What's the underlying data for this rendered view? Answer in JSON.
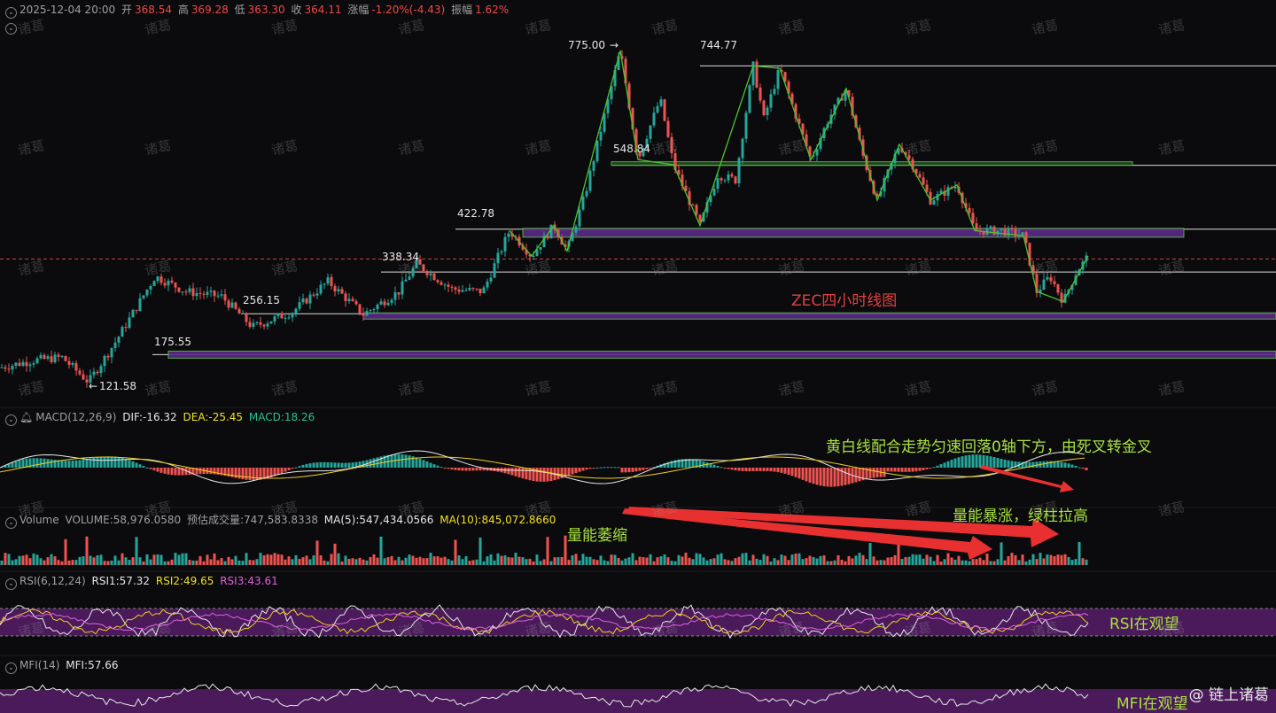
{
  "header": {
    "datetime": "2025-12-04 20:00",
    "open_label": "开",
    "open": "368.54",
    "high_label": "高",
    "high": "369.28",
    "low_label": "低",
    "low": "363.30",
    "close_label": "收",
    "close": "364.11",
    "change_label": "涨幅",
    "change": "-1.20%(-4.43)",
    "amplitude_label": "振幅",
    "amplitude": "1.62%"
  },
  "price_levels": [
    "775.00",
    "744.77",
    "548.84",
    "422.78",
    "338.34",
    "256.15",
    "175.55",
    "121.58"
  ],
  "chart_title": "ZEC四小时线图",
  "macd": {
    "name": "MACD(12,26,9)",
    "dif": "DIF:-16.32",
    "dea": "DEA:-25.45",
    "macd": "MACD:18.26"
  },
  "volume": {
    "name": "Volume",
    "vol": "VOLUME:58,976.0580",
    "est": "预估成交量:747,583.8338",
    "ma5": "MA(5):547,434.0566",
    "ma10": "MA(10):845,072.8660"
  },
  "rsi": {
    "name": "RSI(6,12,24)",
    "rsi1": "RSI1:57.32",
    "rsi2": "RSI2:49.65",
    "rsi3": "RSI3:43.61"
  },
  "mfi": {
    "name": "MFI(14)",
    "mfi": "MFI:57.66"
  },
  "annotations": {
    "macd_note": "黄白线配合走势匀速回落0轴下方，由死叉转金叉",
    "volume_surge": "量能暴涨，绿柱拉高",
    "volume_shrink": "量能萎缩",
    "rsi_note": "RSI在观望",
    "mfi_note": "MFI在观望"
  },
  "watermark": "诸葛",
  "brand": "@ 链上诸葛",
  "colors": {
    "up": "#26a69a",
    "down": "#ef5350",
    "zigzag": "#4cc430",
    "band": "#5a2a86",
    "dif": "#e8e8e8",
    "dea": "#f0d020"
  },
  "chart_data": {
    "type": "candlestick",
    "symbol": "ZEC",
    "timeframe": "4H",
    "swing_points": [
      {
        "label": "121.58",
        "value": 121.58
      },
      {
        "label": "256.15",
        "value": 256.15
      },
      {
        "label": "422.78",
        "value": 422.78
      },
      {
        "label": "775.00",
        "value": 775.0
      },
      {
        "label": "548.84",
        "value": 548.84
      },
      {
        "label": "744.77",
        "value": 744.77
      },
      {
        "label": "338.34",
        "value": 338.34
      }
    ],
    "last_close": 364.11,
    "indicators": {
      "MACD": {
        "DIF": -16.32,
        "DEA": -25.45,
        "MACD": 18.26
      },
      "Volume": {
        "VOLUME": 58976.058,
        "MA5": 547434.0566,
        "MA10": 845072.866
      },
      "RSI": {
        "RSI1": 57.32,
        "RSI2": 49.65,
        "RSI3": 43.61
      },
      "MFI": {
        "MFI": 57.66
      }
    }
  }
}
